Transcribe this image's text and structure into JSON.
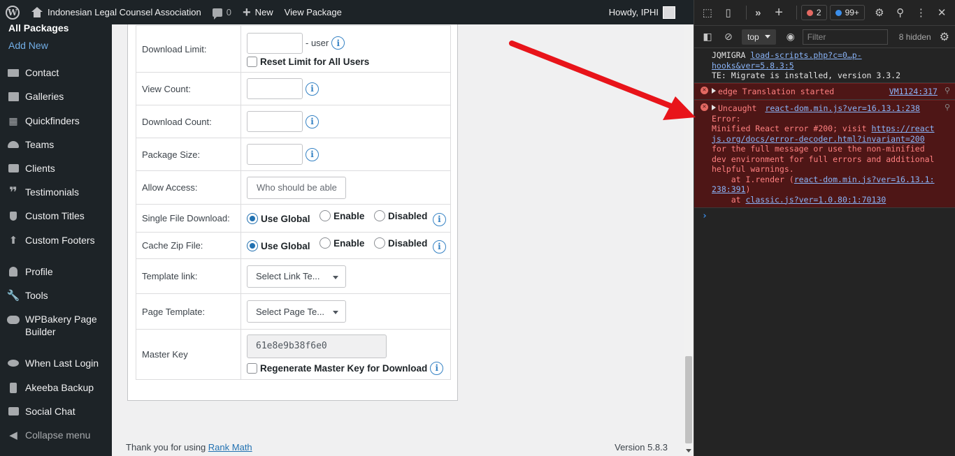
{
  "adminbar": {
    "site_name": "Indonesian Legal Counsel Association",
    "comments_count": "0",
    "new_label": "New",
    "view_package": "View Package",
    "howdy": "Howdy, IPHI"
  },
  "sidebar": {
    "current_sub": "All Packages",
    "add_new": "Add New",
    "items": [
      {
        "label": "Contact",
        "icon": "envelope-icon"
      },
      {
        "label": "Galleries",
        "icon": "images-icon"
      },
      {
        "label": "Quickfinders",
        "icon": "grid-icon"
      },
      {
        "label": "Teams",
        "icon": "people-icon"
      },
      {
        "label": "Clients",
        "icon": "briefcase-icon"
      },
      {
        "label": "Testimonials",
        "icon": "quote-icon"
      },
      {
        "label": "Custom Titles",
        "icon": "pin-icon"
      },
      {
        "label": "Custom Footers",
        "icon": "upload-icon"
      },
      {
        "label": "Profile",
        "icon": "user-icon"
      },
      {
        "label": "Tools",
        "icon": "wrench-icon"
      },
      {
        "label": "WPBakery Page Builder",
        "icon": "cloud-icon"
      },
      {
        "label": "When Last Login",
        "icon": "eye-icon"
      },
      {
        "label": "Akeeba Backup",
        "icon": "backup-icon"
      },
      {
        "label": "Social Chat",
        "icon": "chat-icon"
      },
      {
        "label": "Collapse menu",
        "icon": "collapse-icon"
      }
    ]
  },
  "form": {
    "download_limit": {
      "label": "Download Limit:",
      "suffix": "- user",
      "reset_label": "Reset Limit for All Users"
    },
    "view_count": {
      "label": "View Count:"
    },
    "download_count": {
      "label": "Download Count:"
    },
    "package_size": {
      "label": "Package Size:"
    },
    "allow_access": {
      "label": "Allow Access:",
      "placeholder": "Who should be able"
    },
    "single_file_download": {
      "label": "Single File Download:",
      "options": [
        "Use Global",
        "Enable",
        "Disabled"
      ],
      "selected": "Use Global"
    },
    "cache_zip_file": {
      "label": "Cache Zip File:",
      "options": [
        "Use Global",
        "Enable",
        "Disabled"
      ],
      "selected": "Use Global"
    },
    "template_link": {
      "label": "Template link:",
      "value": "Select Link Te..."
    },
    "page_template": {
      "label": "Page Template:",
      "value": "Select Page Te..."
    },
    "master_key": {
      "label": "Master Key",
      "value": "61e8e9b38f6e0",
      "regenerate_label": "Regenerate Master Key for Download"
    }
  },
  "footer": {
    "thanks_prefix": "Thank you for using ",
    "thanks_link": "Rank Math",
    "version": "Version 5.8.3"
  },
  "devtools": {
    "errors_count": "2",
    "issues_count": "99+",
    "context": "top",
    "filter_placeholder": "Filter",
    "hidden_count": "8 hidden",
    "messages": [
      {
        "type": "info",
        "line1_prefix": "JQMIGRA ",
        "line1_link": "load-scripts.php?c=0…p-hooks&ver=5.8.3:5",
        "line2": "TE: Migrate is installed, version 3.3.2"
      },
      {
        "type": "error",
        "text": "edge Translation started",
        "source": "VM1124:317"
      },
      {
        "type": "error",
        "title": "Uncaught",
        "source": "react-dom.min.js?ver=16.13.1:238",
        "l1": "Error:",
        "l2_pre": "Minified React error #200; visit ",
        "l2_link": "https://reactjs.org/docs/error-decoder.html?invariant=200",
        "l2_post": " for the full message or use the non-minified dev environment for full errors and additional helpful warnings.",
        "at1_pre": "    at I.render (",
        "at1_link": "react-dom.min.js?ver=16.13.1:238:391",
        "at1_post": ")",
        "at2_pre": "    at ",
        "at2_link": "classic.js?ver=1.0.80:1:70130"
      }
    ],
    "prompt": "›"
  },
  "colors": {
    "admin_bg": "#1d2327",
    "link_blue": "#2271b1",
    "error_bg": "#4e1616",
    "arrow_red": "#e8141a"
  }
}
